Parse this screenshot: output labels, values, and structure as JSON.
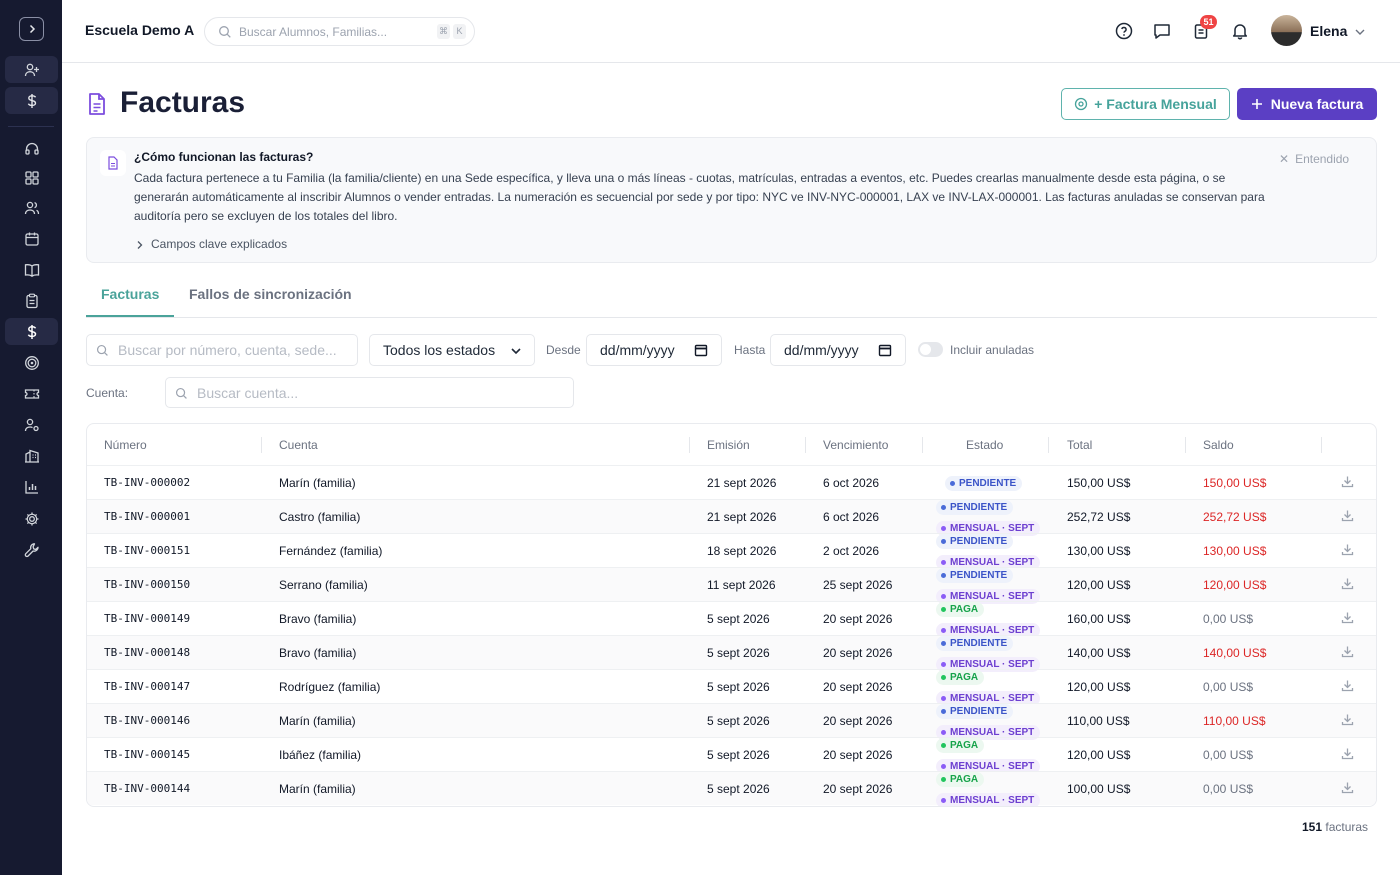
{
  "header": {
    "school_name": "Escuela Demo A",
    "search_placeholder": "Buscar Alumnos, Familias...",
    "shortcut_keys": [
      "⌘",
      "K"
    ],
    "notification_count": "51",
    "user_name": "Elena"
  },
  "page": {
    "title": "Facturas",
    "monthly_button": "+ Factura Mensual",
    "new_button": "Nueva factura"
  },
  "info": {
    "title": "¿Cómo funcionan las facturas?",
    "body": "Cada factura pertenece a tu Familia (la familia/cliente) en una Sede específica, y lleva una o más líneas - cuotas, matrículas, entradas a eventos, etc. Puedes crearlas manualmente desde esta página, o se generarán automáticamente al inscribir Alumnos o vender entradas. La numeración es secuencial por sede y por tipo: NYC ve INV-NYC-000001, LAX ve INV-LAX-000001. Las facturas anuladas se conservan para auditoría pero se excluyen de los totales del libro.",
    "link": "Campos clave explicados",
    "dismiss": "Entendido"
  },
  "tabs": [
    "Facturas",
    "Fallos de sincronización"
  ],
  "filters": {
    "search_placeholder": "Buscar por número, cuenta, sede...",
    "status_select": "Todos los estados",
    "from_label": "Desde",
    "from_value": "dd/mm/yyyy",
    "to_label": "Hasta",
    "to_value": "dd/mm/yyyy",
    "include_voided": "Incluir anuladas",
    "account_label": "Cuenta:",
    "account_placeholder": "Buscar cuenta..."
  },
  "table": {
    "columns": [
      "Número",
      "Cuenta",
      "Emisión",
      "Vencimiento",
      "Estado",
      "Total",
      "Saldo"
    ],
    "rows": [
      {
        "number": "TB-INV-000002",
        "account": "Marín (familia)",
        "issued": "21 sept 2026",
        "due": "6 oct 2026",
        "status": "PENDIENTE",
        "tag": "",
        "total": "150,00 US$",
        "balance": "150,00 US$"
      },
      {
        "number": "TB-INV-000001",
        "account": "Castro (familia)",
        "issued": "21 sept 2026",
        "due": "6 oct 2026",
        "status": "PENDIENTE",
        "tag": "MENSUAL · SEPT",
        "total": "252,72 US$",
        "balance": "252,72 US$"
      },
      {
        "number": "TB-INV-000151",
        "account": "Fernández (familia)",
        "issued": "18 sept 2026",
        "due": "2 oct 2026",
        "status": "PENDIENTE",
        "tag": "MENSUAL · SEPT",
        "total": "130,00 US$",
        "balance": "130,00 US$"
      },
      {
        "number": "TB-INV-000150",
        "account": "Serrano (familia)",
        "issued": "11 sept 2026",
        "due": "25 sept 2026",
        "status": "PENDIENTE",
        "tag": "MENSUAL · SEPT",
        "total": "120,00 US$",
        "balance": "120,00 US$"
      },
      {
        "number": "TB-INV-000149",
        "account": "Bravo (familia)",
        "issued": "5 sept 2026",
        "due": "20 sept 2026",
        "status": "PAGA",
        "tag": "MENSUAL · SEPT",
        "total": "160,00 US$",
        "balance": "0,00 US$"
      },
      {
        "number": "TB-INV-000148",
        "account": "Bravo (familia)",
        "issued": "5 sept 2026",
        "due": "20 sept 2026",
        "status": "PENDIENTE",
        "tag": "MENSUAL · SEPT",
        "total": "140,00 US$",
        "balance": "140,00 US$"
      },
      {
        "number": "TB-INV-000147",
        "account": "Rodríguez (familia)",
        "issued": "5 sept 2026",
        "due": "20 sept 2026",
        "status": "PAGA",
        "tag": "MENSUAL · SEPT",
        "total": "120,00 US$",
        "balance": "0,00 US$"
      },
      {
        "number": "TB-INV-000146",
        "account": "Marín (familia)",
        "issued": "5 sept 2026",
        "due": "20 sept 2026",
        "status": "PENDIENTE",
        "tag": "MENSUAL · SEPT",
        "total": "110,00 US$",
        "balance": "110,00 US$"
      },
      {
        "number": "TB-INV-000145",
        "account": "Ibáñez (familia)",
        "issued": "5 sept 2026",
        "due": "20 sept 2026",
        "status": "PAGA",
        "tag": "MENSUAL · SEPT",
        "total": "120,00 US$",
        "balance": "0,00 US$"
      },
      {
        "number": "TB-INV-000144",
        "account": "Marín (familia)",
        "issued": "5 sept 2026",
        "due": "20 sept 2026",
        "status": "PAGA",
        "tag": "MENSUAL · SEPT",
        "total": "100,00 US$",
        "balance": "0,00 US$"
      }
    ]
  },
  "footer": {
    "count": "151",
    "label": "facturas"
  },
  "colors": {
    "accent": "#5b3fc4",
    "teal": "#4aa39a",
    "danger": "#dc2626",
    "sidebar": "#161a30"
  },
  "sidebar_icons": [
    "expand-icon",
    "add-user-icon",
    "dollar-icon",
    "headset-icon",
    "grid-icon",
    "users-icon",
    "calendar-icon",
    "book-icon",
    "clipboard-icon",
    "dollar-icon",
    "target-icon",
    "ticket-icon",
    "user-settings-icon",
    "building-icon",
    "chart-icon",
    "gear-icon",
    "wrench-icon"
  ]
}
